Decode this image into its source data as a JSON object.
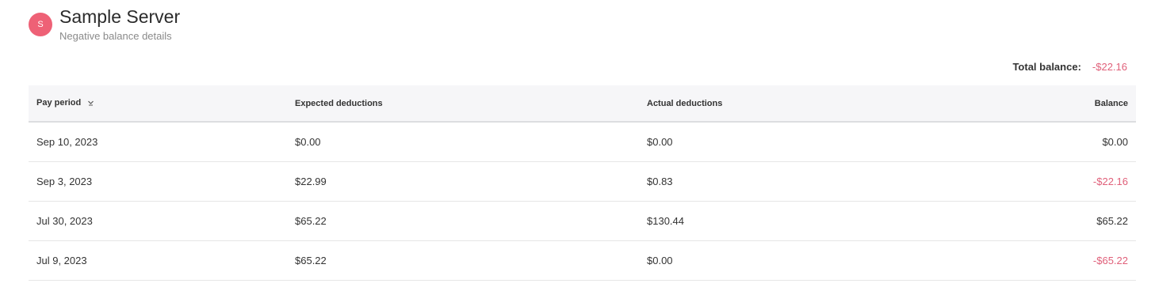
{
  "header": {
    "avatar_initial": "S",
    "title": "Sample Server",
    "subtitle": "Negative balance details"
  },
  "summary": {
    "total_label": "Total balance:",
    "total_value": "-$22.16"
  },
  "table": {
    "columns": {
      "pay_period": "Pay period",
      "expected": "Expected deductions",
      "actual": "Actual deductions",
      "balance": "Balance"
    },
    "sort_icon": "chevron-down-icon",
    "rows": [
      {
        "pay_period": "Sep 10, 2023",
        "expected": "$0.00",
        "actual": "$0.00",
        "balance": "$0.00",
        "negative": false
      },
      {
        "pay_period": "Sep 3, 2023",
        "expected": "$22.99",
        "actual": "$0.83",
        "balance": "-$22.16",
        "negative": true
      },
      {
        "pay_period": "Jul 30, 2023",
        "expected": "$65.22",
        "actual": "$130.44",
        "balance": "$65.22",
        "negative": false
      },
      {
        "pay_period": "Jul 9, 2023",
        "expected": "$65.22",
        "actual": "$0.00",
        "balance": "-$65.22",
        "negative": true
      }
    ]
  },
  "colors": {
    "accent": "#ee6176",
    "negative": "#e0607a",
    "header_bg": "#f6f6f8"
  }
}
